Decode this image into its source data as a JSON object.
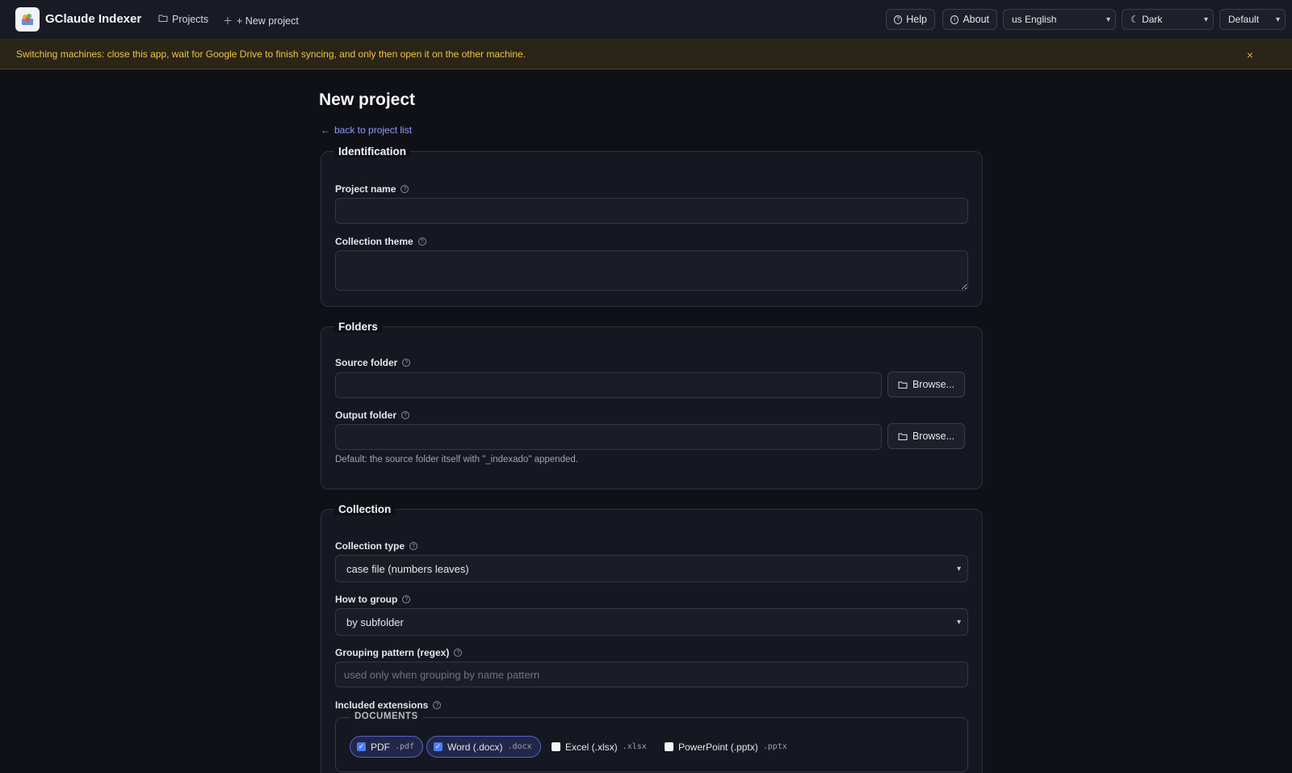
{
  "app": {
    "title": "GClaude Indexer"
  },
  "nav": {
    "projects": "Projects",
    "new_project": "+ New project"
  },
  "toolbar": {
    "help": "Help",
    "about": "About",
    "language": "us English",
    "theme": "☾ Dark",
    "preset": "Default"
  },
  "banner": {
    "text": "Switching machines: close this app, wait for Google Drive to finish syncing, and only then open it on the other machine.",
    "close": "×"
  },
  "page": {
    "title": "New project",
    "back": "back to project list"
  },
  "identification": {
    "legend": "Identification",
    "project_name_label": "Project name",
    "project_name_value": "",
    "theme_label": "Collection theme",
    "theme_value": ""
  },
  "folders": {
    "legend": "Folders",
    "source_label": "Source folder",
    "source_value": "",
    "output_label": "Output folder",
    "output_value": "",
    "browse": "Browse...",
    "output_hint": "Default: the source folder itself with \"_indexado\" appended."
  },
  "collection": {
    "legend": "Collection",
    "type_label": "Collection type",
    "type_value": "case file (numbers leaves)",
    "group_label": "How to group",
    "group_value": "by subfolder",
    "pattern_label": "Grouping pattern (regex)",
    "pattern_placeholder": "used only when grouping by name pattern",
    "pattern_value": "",
    "extensions_label": "Included extensions",
    "documents_legend": "DOCUMENTS",
    "extensions": [
      {
        "label": "PDF",
        "ext": ".pdf",
        "checked": true
      },
      {
        "label": "Word (.docx)",
        "ext": ".docx",
        "checked": true
      },
      {
        "label": "Excel (.xlsx)",
        "ext": ".xlsx",
        "checked": false
      },
      {
        "label": "PowerPoint (.pptx)",
        "ext": ".pptx",
        "checked": false
      }
    ]
  },
  "colors": {
    "accent": "#8f9cff",
    "warning": "#f1c24b",
    "checkbox": "#4a7cf5"
  },
  "icons": {
    "help_dot": "?",
    "back_arrow": "←",
    "folder": "folder-icon",
    "check": "✓",
    "chevron": "⌄"
  }
}
